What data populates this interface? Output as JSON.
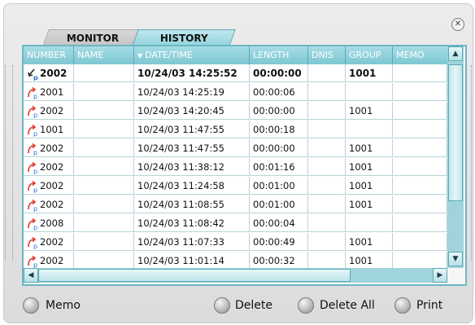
{
  "tabs": [
    {
      "label": "MONITOR"
    },
    {
      "label": "HISTORY"
    }
  ],
  "columns": [
    "NUMBER",
    "NAME",
    "DATE/TIME",
    "LENGTH",
    "DNIS",
    "GROUP",
    "MEMO"
  ],
  "sort_indicator": "▼",
  "rows": [
    {
      "number": "2002",
      "name": "",
      "datetime": "10/24/03 14:25:52",
      "length": "00:00:00",
      "dnis": "",
      "group": "1001",
      "memo": "",
      "icon": "incoming-call-icon"
    },
    {
      "number": "2001",
      "name": "",
      "datetime": "10/24/03 14:25:19",
      "length": "00:00:06",
      "dnis": "",
      "group": "",
      "memo": "",
      "icon": "outgoing-call-icon"
    },
    {
      "number": "2002",
      "name": "",
      "datetime": "10/24/03 14:20:45",
      "length": "00:00:00",
      "dnis": "",
      "group": "1001",
      "memo": "",
      "icon": "outgoing-call-icon"
    },
    {
      "number": "1001",
      "name": "",
      "datetime": "10/24/03 11:47:55",
      "length": "00:00:18",
      "dnis": "",
      "group": "",
      "memo": "",
      "icon": "outgoing-call-icon"
    },
    {
      "number": "2002",
      "name": "",
      "datetime": "10/24/03 11:47:55",
      "length": "00:00:00",
      "dnis": "",
      "group": "1001",
      "memo": "",
      "icon": "outgoing-call-icon"
    },
    {
      "number": "2002",
      "name": "",
      "datetime": "10/24/03 11:38:12",
      "length": "00:01:16",
      "dnis": "",
      "group": "1001",
      "memo": "",
      "icon": "outgoing-call-icon"
    },
    {
      "number": "2002",
      "name": "",
      "datetime": "10/24/03 11:24:58",
      "length": "00:01:00",
      "dnis": "",
      "group": "1001",
      "memo": "",
      "icon": "outgoing-call-icon"
    },
    {
      "number": "2002",
      "name": "",
      "datetime": "10/24/03 11:08:55",
      "length": "00:01:00",
      "dnis": "",
      "group": "1001",
      "memo": "",
      "icon": "outgoing-call-icon"
    },
    {
      "number": "2008",
      "name": "",
      "datetime": "10/24/03 11:08:42",
      "length": "00:00:04",
      "dnis": "",
      "group": "",
      "memo": "",
      "icon": "outgoing-call-icon"
    },
    {
      "number": "2002",
      "name": "",
      "datetime": "10/24/03 11:07:33",
      "length": "00:00:49",
      "dnis": "",
      "group": "1001",
      "memo": "",
      "icon": "outgoing-call-icon"
    },
    {
      "number": "2002",
      "name": "",
      "datetime": "10/24/03 11:01:14",
      "length": "00:00:32",
      "dnis": "",
      "group": "1001",
      "memo": "",
      "icon": "outgoing-call-icon"
    }
  ],
  "buttons": {
    "memo": "Memo",
    "delete": "Delete",
    "delete_all": "Delete All",
    "print": "Print"
  },
  "colors": {
    "accent": "#7dc7d2",
    "call_arrow": "#e0382a",
    "call_p": "#2b6fd0"
  }
}
